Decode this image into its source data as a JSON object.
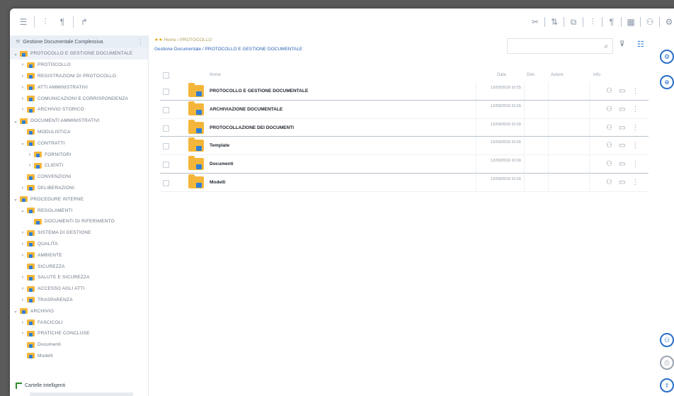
{
  "toolbar": {
    "left_icons": [
      "menu-icon",
      "tree-icon",
      "paragraph-icon",
      "branch-icon"
    ],
    "right_icons": [
      "scissors-icon",
      "move-icon",
      "copy-icon",
      "paste-icon",
      "paragraph-icon",
      "calendar-icon",
      "user-icon",
      "settings-icon"
    ]
  },
  "sidebar": {
    "header": "Gestione Documentale Complessiva",
    "items": [
      {
        "label": "PROTOCOLLO E GESTIONE DOCUMENTALE",
        "level": 0,
        "chevron": "v",
        "selected": true
      },
      {
        "label": "PROTOCOLLO",
        "level": 1,
        "chevron": ">"
      },
      {
        "label": "REGISTRAZIONI DI PROTOCOLLO",
        "level": 1,
        "chevron": ">"
      },
      {
        "label": "ATTI AMMINISTRATIVI",
        "level": 1,
        "chevron": ">"
      },
      {
        "label": "COMUNICAZIONI E CORRISPONDENZA",
        "level": 1,
        "chevron": ">"
      },
      {
        "label": "ARCHIVIO STORICO",
        "level": 1,
        "chevron": ">"
      },
      {
        "label": "DOCUMENTI AMMINISTRATIVI",
        "level": 0,
        "chevron": "v"
      },
      {
        "label": "MODULISTICA",
        "level": 1,
        "chevron": ""
      },
      {
        "label": "CONTRATTI",
        "level": 1,
        "chevron": "v"
      },
      {
        "label": "FORNITORI",
        "level": 2,
        "chevron": ">"
      },
      {
        "label": "CLIENTI",
        "level": 2,
        "chevron": ">"
      },
      {
        "label": "CONVENZIONI",
        "level": 1,
        "chevron": ""
      },
      {
        "label": "DELIBERAZIONI",
        "level": 1,
        "chevron": ">"
      },
      {
        "label": "PROCEDURE INTERNE",
        "level": 0,
        "chevron": "v"
      },
      {
        "label": "REGOLAMENTI",
        "level": 1,
        "chevron": "v"
      },
      {
        "label": "DOCUMENTI DI RIFERIMENTO",
        "level": 2,
        "chevron": ""
      },
      {
        "label": "SISTEMA DI GESTIONE",
        "level": 1,
        "chevron": ">"
      },
      {
        "label": "QUALITA",
        "level": 1,
        "chevron": ">"
      },
      {
        "label": "AMBIENTE",
        "level": 1,
        "chevron": ">"
      },
      {
        "label": "SICUREZZA",
        "level": 1,
        "chevron": ""
      },
      {
        "label": "SALUTE E SICUREZZA",
        "level": 1,
        "chevron": ">"
      },
      {
        "label": "ACCESSO AGLI ATTI",
        "level": 1,
        "chevron": ">"
      },
      {
        "label": "TRASPARENZA",
        "level": 1,
        "chevron": ">"
      },
      {
        "label": "ARCHIVIO",
        "level": 0,
        "chevron": "v"
      },
      {
        "label": "FASCICOLI",
        "level": 1,
        "chevron": ">"
      },
      {
        "label": "PRATICHE CONCLUSE",
        "level": 1,
        "chevron": ">"
      },
      {
        "label": "Documenti",
        "level": 1,
        "chevron": ""
      },
      {
        "label": "Modelli",
        "level": 1,
        "chevron": ""
      }
    ],
    "smart_folders": "Cartelle intelligenti"
  },
  "main": {
    "breadcrumb": "Home / PROTOCOLLO",
    "path_text": "Gestione Documentale / PROTOCOLLO E GESTIONE DOCUMENTALE",
    "columns": {
      "name": "Nome",
      "date": "Data",
      "size": "Dim.",
      "author": "Autore",
      "info": "Info"
    },
    "rows": [
      {
        "name": "PROTOCOLLO E GESTIONE DOCUMENTALE",
        "date": "12/03/2019 10:15",
        "divider": true
      },
      {
        "name": "ARCHIVIAZIONE DOCUMENTALE",
        "date": "12/03/2019 10:15",
        "divider": false
      },
      {
        "name": "PROTOCOLLAZIONE DEI DOCUMENTI",
        "date": "12/03/2019 10:15",
        "divider": true
      },
      {
        "name": "Template",
        "date": "12/03/2019 10:16",
        "divider": false
      },
      {
        "name": "Documenti",
        "date": "12/03/2019 10:16",
        "divider": true
      },
      {
        "name": "Modelli",
        "date": "12/03/2019 10:16",
        "divider": false
      }
    ]
  },
  "rail": [
    "workflow-icon",
    "share-icon",
    "add-user-icon",
    "print-icon",
    "export-icon"
  ],
  "colors": {
    "folder": "#f4b63a",
    "accent": "#2f7fd4"
  }
}
